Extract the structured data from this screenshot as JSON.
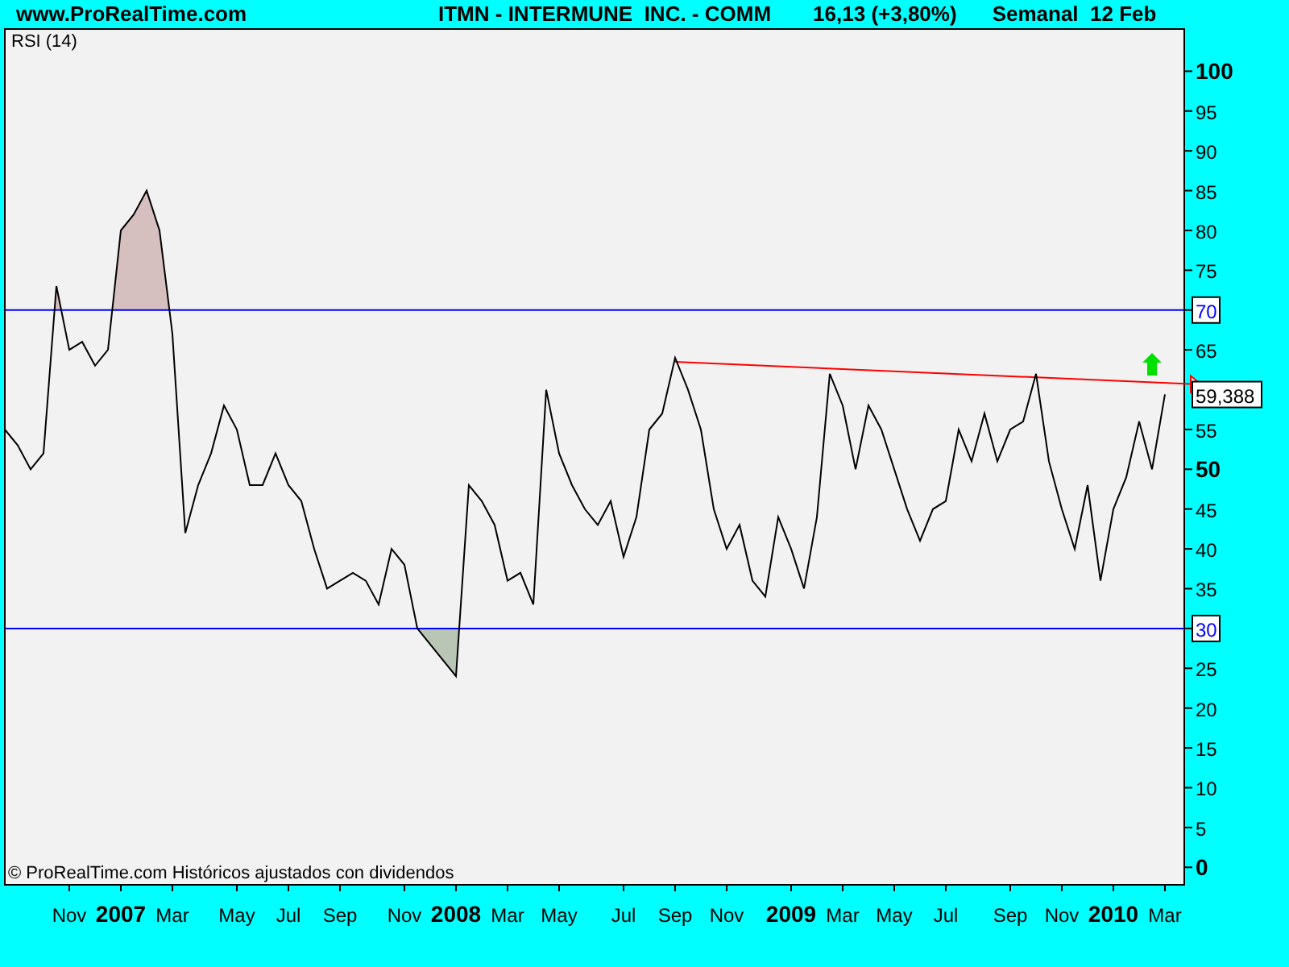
{
  "header": {
    "site": "www.ProRealTime.com",
    "instrument": "ITMN - INTERMUNE  INC. - COMM",
    "price": "16,13 (+3,80%)",
    "period": "Semanal  12 Feb"
  },
  "panel": {
    "footer": "© ProRealTime.com  Históricos ajustados con dividendos",
    "chart_data": {
      "type": "line",
      "title": "RSI (14)",
      "categories": [
        null,
        null,
        null,
        null,
        null,
        "Nov",
        null,
        null,
        null,
        "2007",
        null,
        null,
        null,
        "Mar",
        null,
        null,
        null,
        null,
        "May",
        null,
        null,
        null,
        "Jul",
        null,
        null,
        null,
        "Sep",
        null,
        null,
        null,
        null,
        "Nov",
        null,
        null,
        null,
        "2008",
        null,
        null,
        null,
        "Mar",
        null,
        null,
        null,
        "May",
        null,
        null,
        null,
        null,
        "Jul",
        null,
        null,
        null,
        "Sep",
        null,
        null,
        null,
        "Nov",
        null,
        null,
        null,
        null,
        "2009",
        null,
        null,
        null,
        "Mar",
        null,
        null,
        null,
        "May",
        null,
        null,
        null,
        "Jul",
        null,
        null,
        null,
        null,
        "Sep",
        null,
        null,
        null,
        "Nov",
        null,
        null,
        null,
        "2010",
        null,
        null,
        null,
        "Mar"
      ],
      "series": [
        {
          "color": "#000000",
          "values": [
            55,
            53,
            50,
            52,
            73,
            65,
            66,
            63,
            65,
            80,
            82,
            85,
            80,
            67,
            42,
            48,
            52,
            58,
            55,
            48,
            48,
            52,
            48,
            46,
            40,
            35,
            36,
            37,
            36,
            33,
            40,
            38,
            30,
            28,
            26,
            24,
            48,
            46,
            43,
            36,
            37,
            33,
            60,
            52,
            48,
            45,
            43,
            46,
            39,
            44,
            55,
            57,
            64,
            60,
            55,
            45,
            40,
            43,
            36,
            34,
            44,
            40,
            35,
            44,
            62,
            58,
            50,
            58,
            55,
            50,
            45,
            41,
            45,
            46,
            55,
            51,
            57,
            51,
            55,
            56,
            62,
            51,
            45,
            40,
            48,
            36,
            45,
            49,
            56,
            50,
            59.4
          ]
        }
      ],
      "ylim": [
        -2.2,
        105.3
      ],
      "yticks": [
        0,
        5,
        10,
        15,
        20,
        25,
        30,
        35,
        40,
        45,
        50,
        55,
        65,
        70,
        75,
        80,
        85,
        90,
        95,
        100
      ],
      "ref_lines": [
        {
          "label": "70"
        },
        {
          "label": "30"
        }
      ]
    },
    "last_value": {
      "label": "59,388"
    }
  }
}
